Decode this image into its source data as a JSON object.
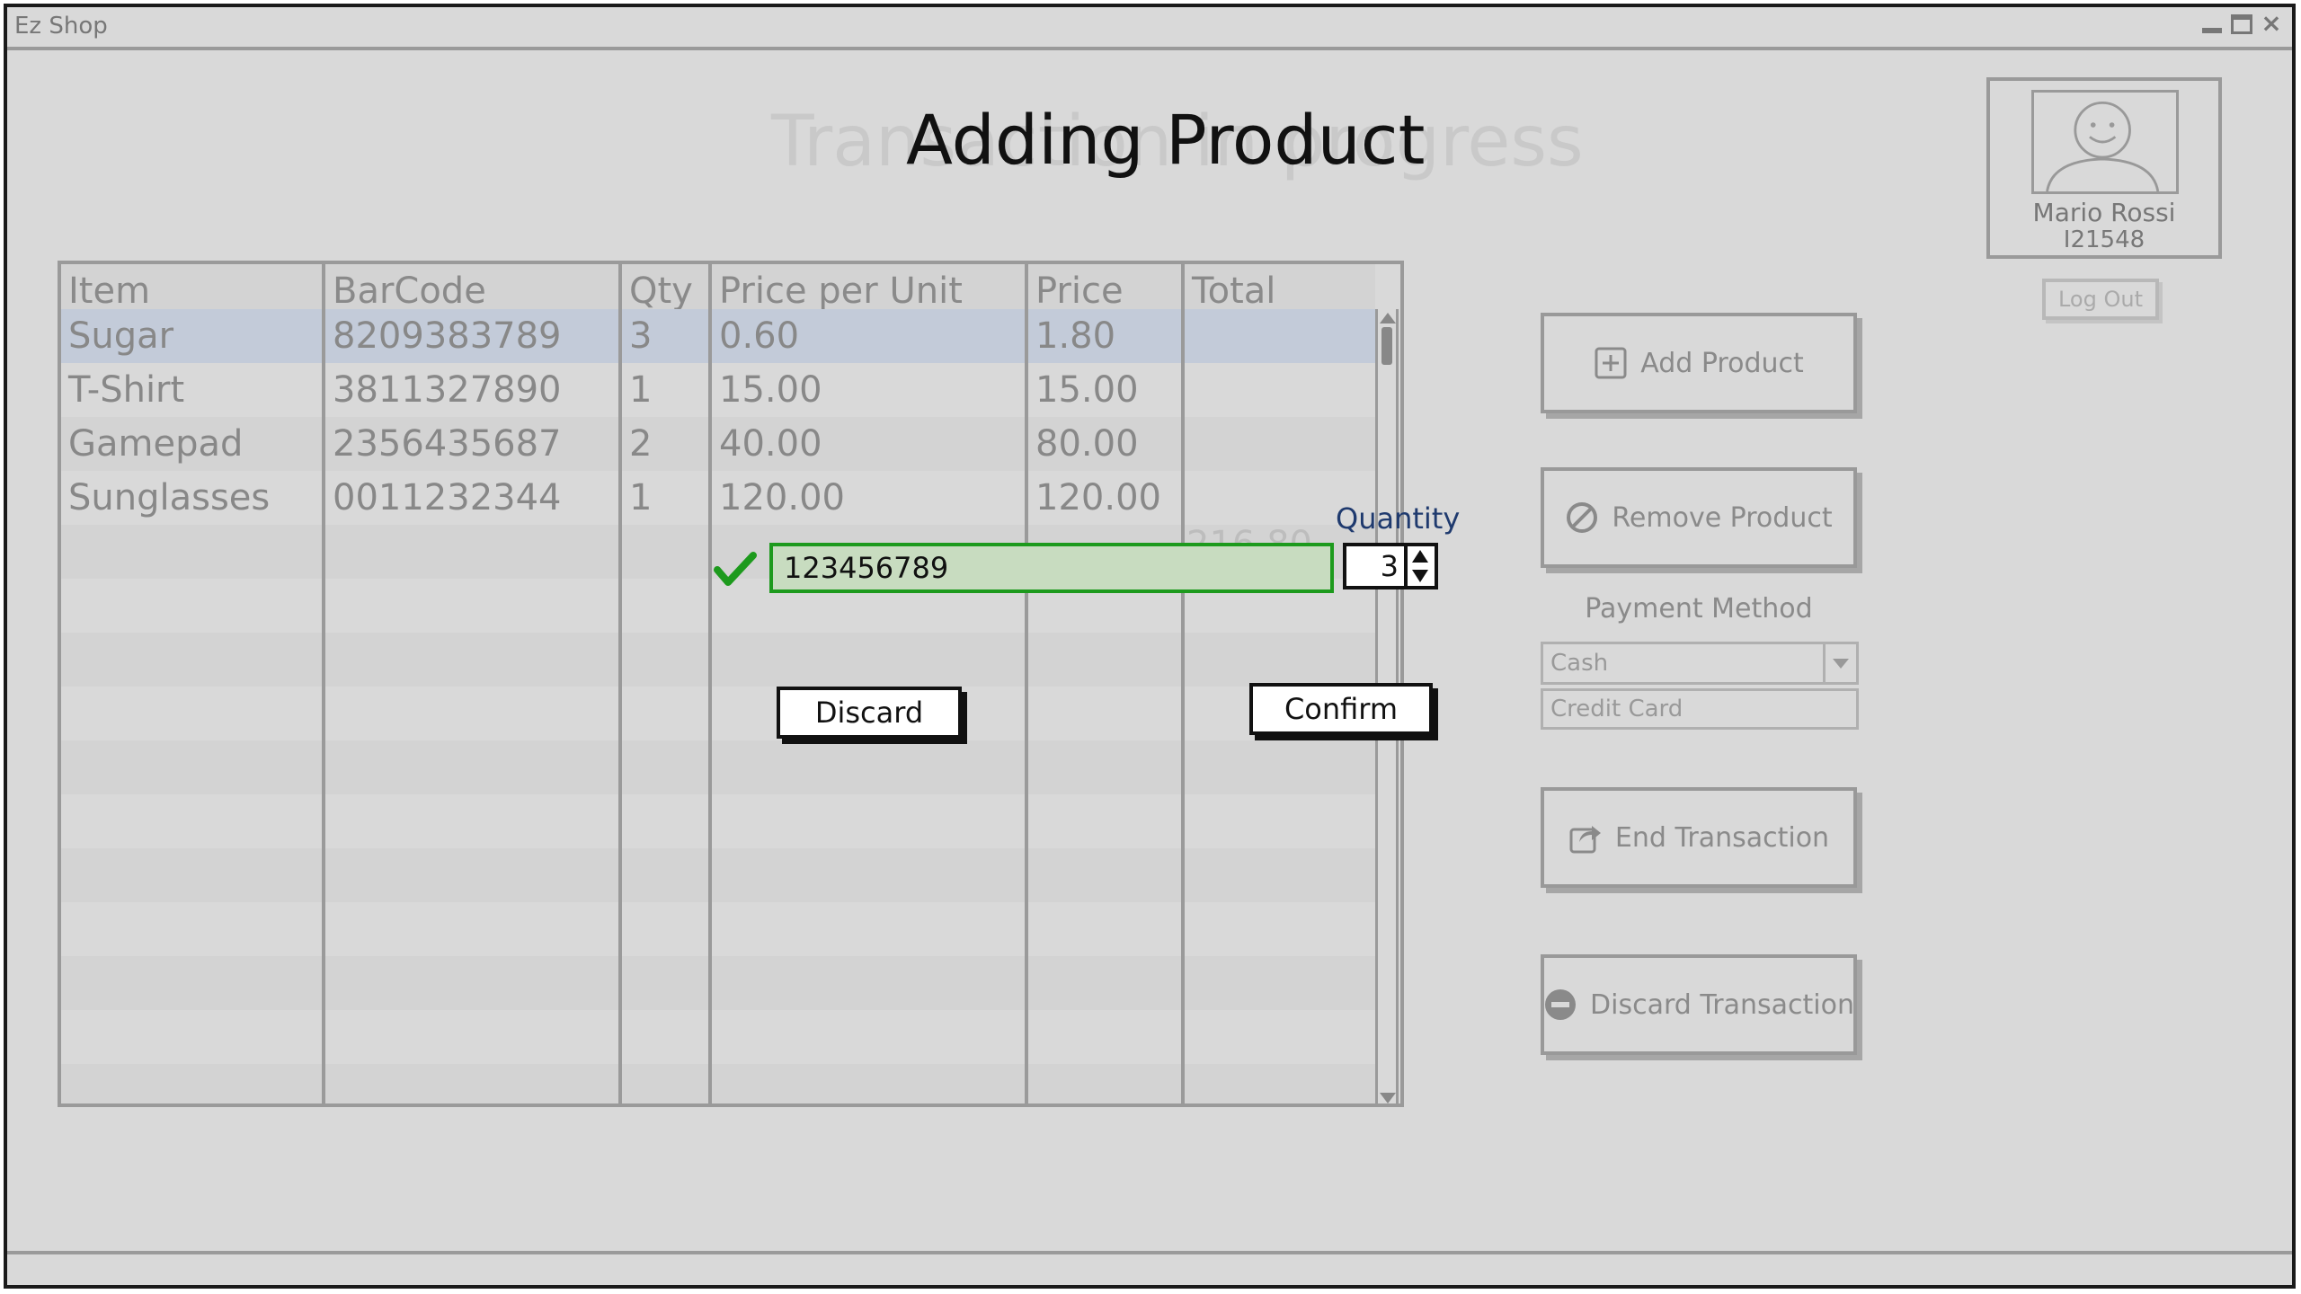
{
  "window": {
    "title": "Ez Shop"
  },
  "background_title": "Transaction in progress",
  "dialog": {
    "title": "Adding Product",
    "barcode_value": "123456789",
    "quantity_label": "Quantity",
    "quantity_value": "3",
    "discard_label": "Discard",
    "confirm_label": "Confirm"
  },
  "table": {
    "headers": [
      "Item",
      "BarCode",
      "Qty",
      "Price per Unit",
      "Price",
      "Total"
    ],
    "rows": [
      {
        "item": "Sugar",
        "barcode": "8209383789",
        "qty": "3",
        "unit": "0.60",
        "price": "1.80"
      },
      {
        "item": "T-Shirt",
        "barcode": "3811327890",
        "qty": "1",
        "unit": "15.00",
        "price": "15.00"
      },
      {
        "item": "Gamepad",
        "barcode": "2356435687",
        "qty": "2",
        "unit": "40.00",
        "price": "80.00"
      },
      {
        "item": "Sunglasses",
        "barcode": "0011232344",
        "qty": "1",
        "unit": "120.00",
        "price": "120.00"
      }
    ],
    "total": "216.80"
  },
  "user": {
    "name": "Mario Rossi",
    "id": "I21548",
    "logout_label": "Log Out"
  },
  "actions": {
    "add_product": "Add Product",
    "remove_product": "Remove Product",
    "end_transaction": "End Transaction",
    "discard_transaction": "Discard Transaction"
  },
  "payment": {
    "label": "Payment Method",
    "selected": "Cash",
    "option": "Credit Card"
  },
  "colors": {
    "window_bg": "#d9d9d9",
    "selected_row": "#c3cbd9",
    "valid_green": "#1d9a1d",
    "quantity_label": "#1f3a6e"
  }
}
